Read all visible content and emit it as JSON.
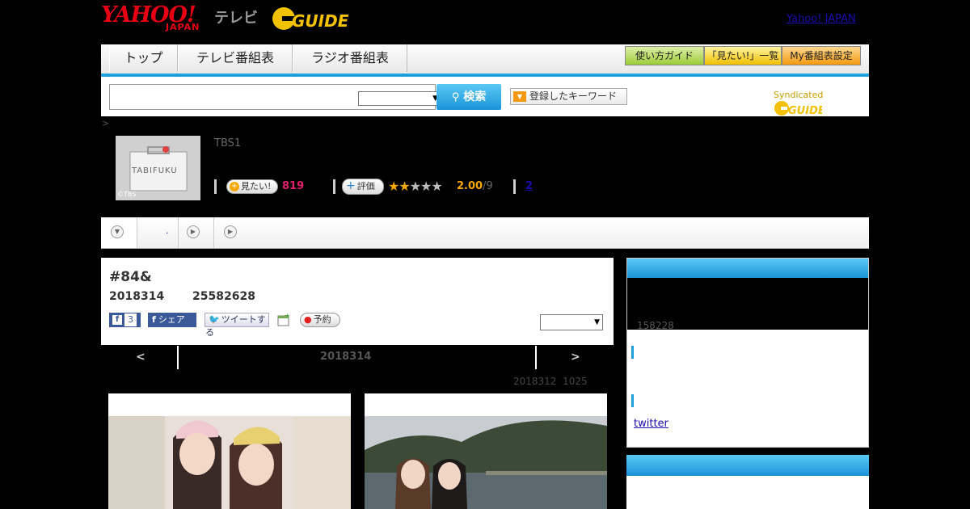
{
  "header": {
    "logo_yahoo": "YAHOO!",
    "logo_japan": "JAPAN",
    "logo_tv": "テレビ",
    "logo_gguide": "GUIDE",
    "yahoo_japan_link": "Yahoo! JAPAN"
  },
  "nav": {
    "tabs": [
      "トップ",
      "テレビ番組表",
      "ラジオ番組表"
    ],
    "guide_buttons": [
      "使い方ガイド",
      "「見たい!」一覧",
      "My番組表設定"
    ]
  },
  "search": {
    "value": "",
    "select_value": "",
    "button_label": "検索",
    "keyword_button": "登録したキーワード",
    "syndicated": "Syndicated"
  },
  "breadcrumb": ">",
  "program": {
    "channel": "TBS1",
    "thumb_label": "TABIFUKU",
    "thumb_badge": "©TBS",
    "want_label": "見たい!",
    "want_count": "819",
    "rate_label": "評価",
    "rating_value": 2,
    "rating_max": 5,
    "rating_text": "2.00",
    "rating_count": "/9",
    "review_link": "2"
  },
  "tabs_row": {
    "dot": "."
  },
  "episode": {
    "title": "#84&",
    "date": "2018314",
    "time": "25582628",
    "fb_count": "3",
    "share_label": "シェア",
    "tweet_label": "ツイートする",
    "reserve_label": "予約",
    "select_value": ""
  },
  "pager": {
    "prev": "<",
    "next": ">",
    "date": "2018314",
    "updated": "2018312  1025"
  },
  "sidebar": {
    "counter": "158228",
    "twitter_link": "twitter"
  },
  "colors": {
    "accent_blue": "#1ea0dc",
    "want_pink": "#e0206a",
    "rating_gold": "#f5a800",
    "gguide_yellow": "#f2c200"
  }
}
